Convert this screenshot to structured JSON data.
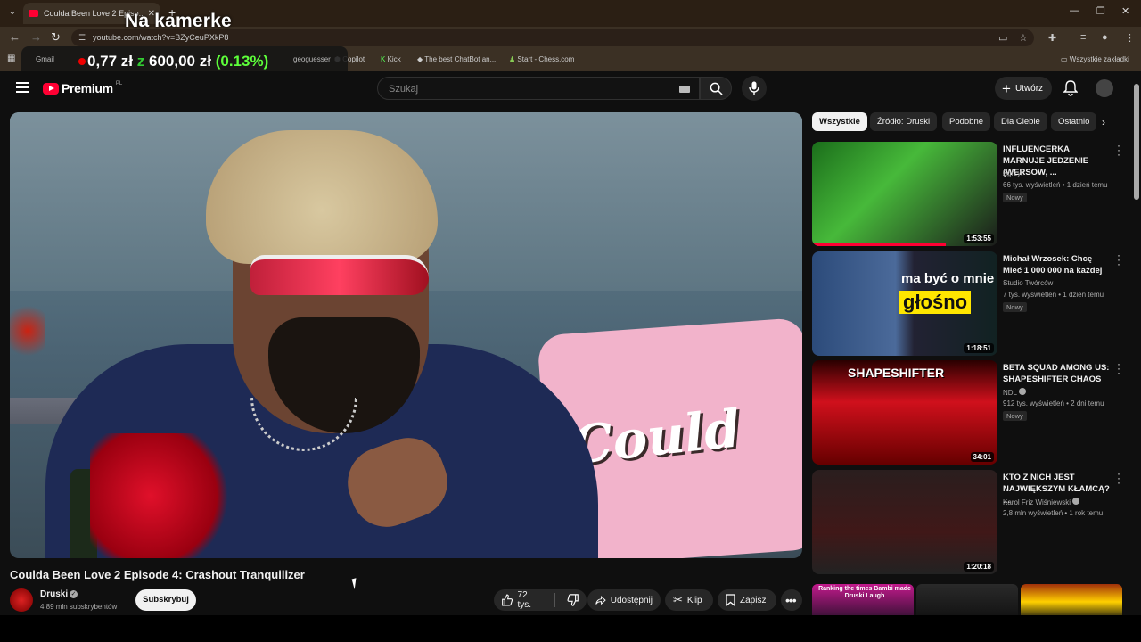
{
  "browser": {
    "tab_title": "Coulda Been Love 2 Episo...",
    "url": "youtube.com/watch?v=BZyCeuPXkP8",
    "bookmarks": [
      "Gmail",
      "geoguesser",
      "Copilot",
      "Kick",
      "The best ChatBot an...",
      "Start - Chess.com",
      "Wszystkie zakładki"
    ],
    "overlay_title": "Na kamerke",
    "price": {
      "left": "0,77 zł",
      "mid": "z",
      "right": "600,00 zł",
      "pct": "(0.13%)"
    }
  },
  "header": {
    "brand": "Premium",
    "brand_sup": "PL",
    "search_placeholder": "Szukaj",
    "create_label": "Utwórz"
  },
  "video": {
    "title": "Coulda Been Love 2 Episode 4: Crashout Tranquilizer",
    "pillow_text": "Could",
    "channel": "Druski",
    "subscribers": "4,89 mln subskrybentów",
    "subscribe_label": "Subskrybuj",
    "likes": "72 tys.",
    "share_label": "Udostępnij",
    "clip_label": "Klip",
    "save_label": "Zapisz"
  },
  "chips": [
    "Wszystkie",
    "Źródło: Druski",
    "Podobne",
    "Dla Ciebie",
    "Ostatnio"
  ],
  "recommendations": [
    {
      "title": "INFLUENCERKA MARNUJE JEDZENIE (WERSOW, ...",
      "channel": "Zgrzyt",
      "meta": "66 tys. wyświetleń • 1 dzień temu",
      "badge": "Nowy",
      "duration": "1:53:55",
      "watched": 0.72
    },
    {
      "title": "Michał Wrzosek: Chcę Mieć 1 000 000 na każdej ...",
      "channel": "Studio Twórców",
      "meta": "7 tys. wyświetleń • 1 dzień temu",
      "badge": "Nowy",
      "duration": "1:18:51",
      "caption1": "ma być o mnie",
      "caption2": "głośno"
    },
    {
      "title": "BETA SQUAD AMONG US: SHAPESHIFTER CHAOS",
      "channel": "NDL",
      "meta": "912 tys. wyświetleń • 2 dni temu",
      "badge": "Nowy",
      "duration": "34:01",
      "caption": "SHAPESHIFTER"
    },
    {
      "title": "KTO Z NICH JEST NAJWIĘKSZYM KŁAMCĄ? ...",
      "channel": "Karol Friz Wiśniewski",
      "meta": "2,8 mln wyświetleń • 1 rok temu",
      "duration": "1:20:18"
    }
  ],
  "mini_caption": "Ranking the times Bambi made Druski Laugh"
}
